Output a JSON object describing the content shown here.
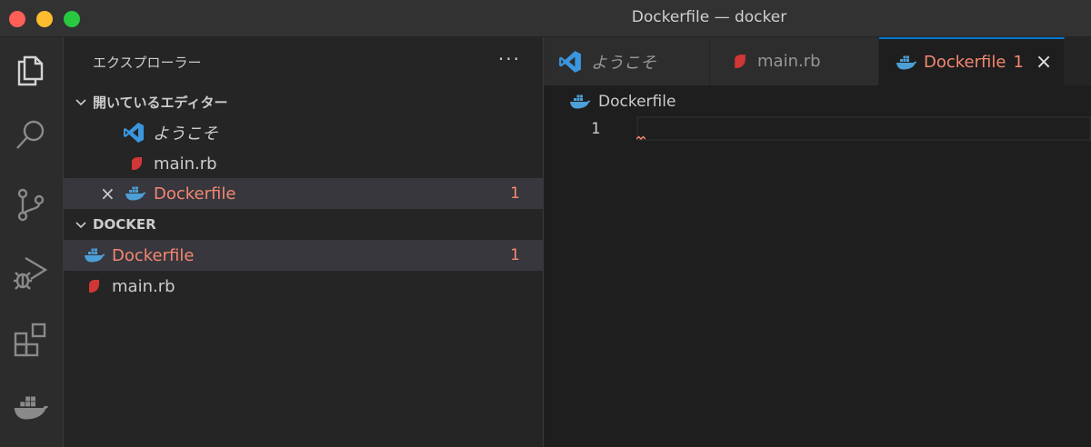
{
  "window": {
    "title": "Dockerfile — docker"
  },
  "activity_bar": {
    "items": [
      {
        "icon": "files-icon"
      },
      {
        "icon": "search-icon"
      },
      {
        "icon": "source-control-icon"
      },
      {
        "icon": "run-debug-icon"
      },
      {
        "icon": "extensions-icon"
      },
      {
        "icon": "docker-icon"
      }
    ]
  },
  "sidebar": {
    "title": "エクスプローラー",
    "more_label": "···",
    "open_editors": {
      "title": "開いているエディター",
      "items": [
        {
          "label": "ようこそ",
          "icon": "vscode-icon"
        },
        {
          "label": "main.rb",
          "icon": "ruby-icon"
        },
        {
          "label": "Dockerfile",
          "icon": "docker-icon",
          "badge": "1",
          "close": "×"
        }
      ]
    },
    "folder": {
      "title": "DOCKER",
      "items": [
        {
          "label": "Dockerfile",
          "icon": "docker-icon",
          "badge": "1"
        },
        {
          "label": "main.rb",
          "icon": "ruby-icon"
        }
      ]
    }
  },
  "editor": {
    "tabs": [
      {
        "label": "ようこそ",
        "icon": "vscode-icon"
      },
      {
        "label": "main.rb",
        "icon": "ruby-icon"
      },
      {
        "label": "Dockerfile",
        "icon": "docker-icon",
        "badge": "1",
        "close": "×"
      }
    ],
    "breadcrumb": "Dockerfile",
    "line_number": "1"
  },
  "colors": {
    "accent": "#0078d4",
    "modified": "#f48771",
    "docker": "#4d9fd6",
    "ruby": "#d13737",
    "vscode": "#3a96dd"
  }
}
